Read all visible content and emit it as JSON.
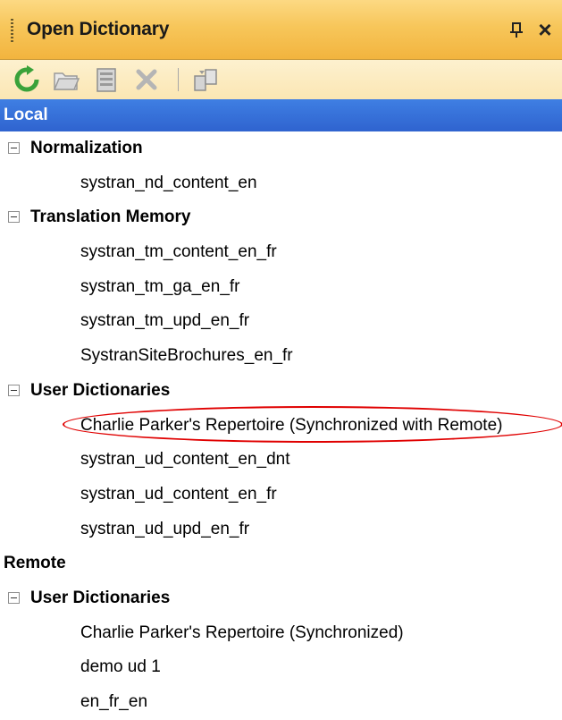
{
  "panel": {
    "title": "Open Dictionary",
    "pin_icon": "pin-icon",
    "close_label": "×"
  },
  "toolbar": {
    "buttons": [
      {
        "name": "refresh-button",
        "icon": "refresh-icon"
      },
      {
        "name": "open-folder-button",
        "icon": "open-folder-icon"
      },
      {
        "name": "import-button",
        "icon": "import-icon"
      },
      {
        "name": "delete-button",
        "icon": "delete-icon"
      },
      {
        "name": "synchronize-button",
        "icon": "synchronize-icon"
      }
    ]
  },
  "colors": {
    "title_bar": "#f7c65a",
    "toolbar": "#fcebc1",
    "local_bar": "#3470d8",
    "highlight": "#e00000"
  },
  "tree": {
    "local_label": "Local",
    "local": {
      "normalization": {
        "label": "Normalization",
        "items": [
          "systran_nd_content_en"
        ]
      },
      "translation_memory": {
        "label": "Translation Memory",
        "items": [
          "systran_tm_content_en_fr",
          "systran_tm_ga_en_fr",
          "systran_tm_upd_en_fr",
          "SystranSiteBrochures_en_fr"
        ]
      },
      "user_dictionaries": {
        "label": "User Dictionaries",
        "items": [
          "Charlie Parker's Repertoire (Synchronized with Remote)",
          "systran_ud_content_en_dnt",
          "systran_ud_content_en_fr",
          "systran_ud_upd_en_fr"
        ]
      }
    },
    "remote_label": "Remote",
    "remote": {
      "user_dictionaries": {
        "label": "User Dictionaries",
        "items": [
          "Charlie Parker's Repertoire (Synchronized)",
          "demo ud 1",
          "en_fr_en"
        ]
      }
    }
  }
}
